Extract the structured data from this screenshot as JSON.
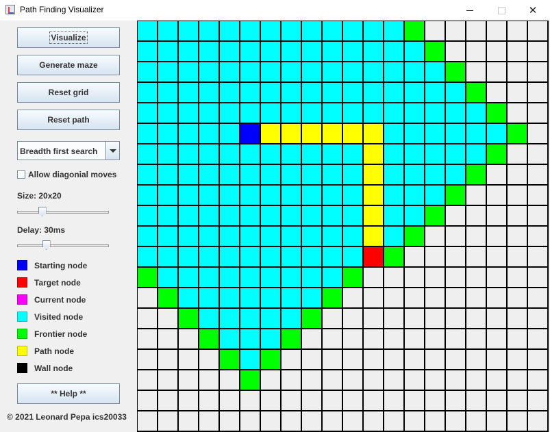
{
  "window": {
    "title": "Path Finding Visualizer",
    "app_icon": "java-app-icon",
    "minimize_icon": "minimize-icon",
    "maximize_icon": "maximize-icon",
    "close_icon": "close-icon"
  },
  "sidebar": {
    "buttons": {
      "visualize": "Visualize",
      "generate_maze": "Generate maze",
      "reset_grid": "Reset grid",
      "reset_path": "Reset path",
      "help": "** Help **"
    },
    "algorithm": {
      "selected": "Breadth first search",
      "arrow_icon": "chevron-down-icon"
    },
    "diagonal": {
      "label": "Allow diagonial moves",
      "checked": false
    },
    "size": {
      "label": "Size: 20x20",
      "slider_fraction": 0.25
    },
    "delay": {
      "label": "Delay: 30ms",
      "slider_fraction": 0.3
    },
    "legend": [
      {
        "key": "start",
        "label": "Starting node",
        "color": "#0000ff"
      },
      {
        "key": "target",
        "label": "Target node",
        "color": "#ff0000"
      },
      {
        "key": "current",
        "label": "Current node",
        "color": "#ff00ff"
      },
      {
        "key": "visited",
        "label": "Visited node",
        "color": "#00ffff"
      },
      {
        "key": "frontier",
        "label": "Frontier node",
        "color": "#00ff00"
      },
      {
        "key": "path",
        "label": "Path node",
        "color": "#ffff00"
      },
      {
        "key": "wall",
        "label": "Wall node",
        "color": "#000000"
      }
    ],
    "copyright": "© 2021 Leonard Pepa ics20033"
  },
  "grid": {
    "size": 20,
    "cell_codes": {
      "u": "unvisited",
      "v": "visited",
      "f": "frontier",
      "p": "path",
      "s": "start",
      "t": "target",
      "c": "current",
      "w": "wall"
    },
    "rows": [
      "vvvvvvvvvvvvvfuuuuuu",
      "vvvvvvvvvvvvvvfuuuuu",
      "vvvvvvvvvvvvvvvfuuuu",
      "vvvvvvvvvvvvvvvvfuuu",
      "vvvvvvvvvvvvvvvvvfuu",
      "vvvvvsppppppvvvvvvfu",
      "vvvvvvvvvvvpvvvvvfuu",
      "vvvvvvvvvvvpvvvvfuuu",
      "vvvvvvvvvvvpvvvfuuuu",
      "vvvvvvvvvvvpvvfuuuuu",
      "vvvvvvvvvvvpvfuuuuuu",
      "vvvvvvvvvvvtfuuuuuuu",
      "fvvvvvvvvvfuuuuuuuuu",
      "ufvvvvvvvfuuuuuuuuuu",
      "uufvvvvvfuuuuuuuuuuu",
      "uuufvvvfuuuuuuuuuuuu",
      "uuuufvfuuuuuuuuuuuuu",
      "uuuuufuuuuuuuuuuuuuu",
      "uuuuuuuuuuuuuuuuuuuu",
      "uuuuuuuuuuuuuuuuuuuu"
    ]
  }
}
